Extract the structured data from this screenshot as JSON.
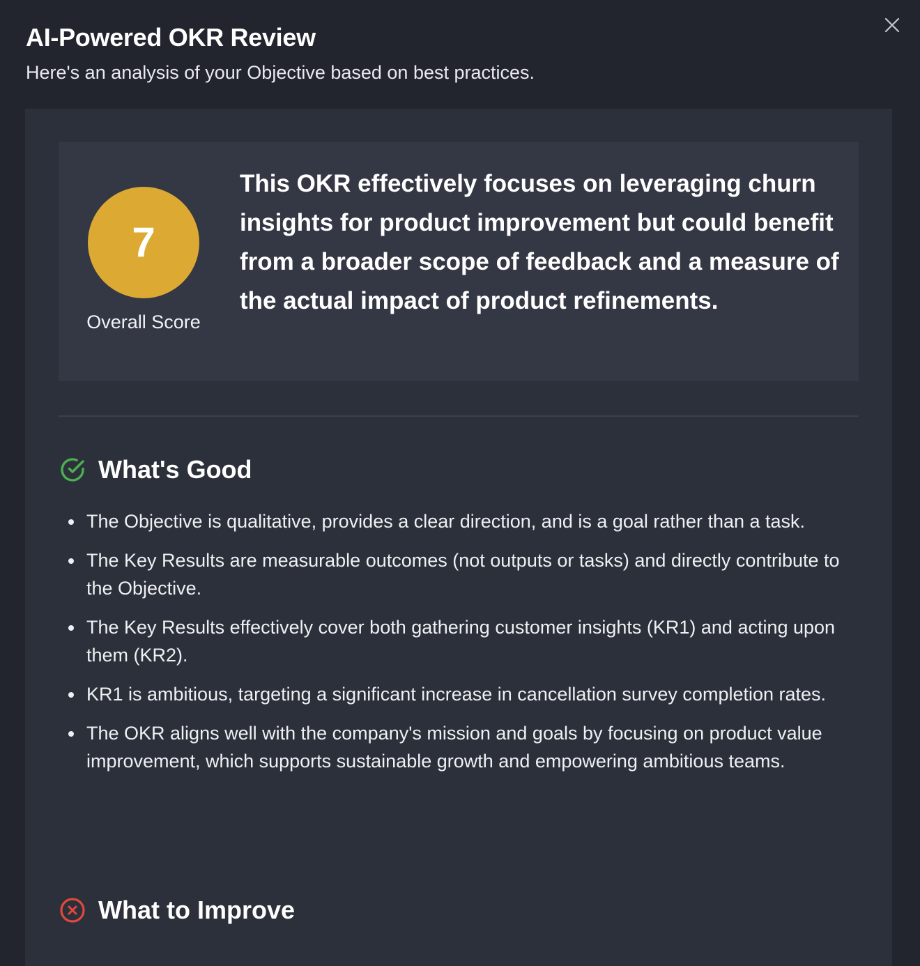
{
  "modal": {
    "title": "AI-Powered OKR Review",
    "subtitle": "Here's an analysis of your Objective based on best practices.",
    "close_icon": "close-icon"
  },
  "score": {
    "value": "7",
    "label": "Overall Score",
    "color": "#dcaa33",
    "summary": "This OKR effectively focuses on leveraging churn insights for product improvement but could benefit from a broader scope of feedback and a measure of the actual impact of product refinements."
  },
  "good": {
    "title": "What's Good",
    "icon": "check-circle-icon",
    "color": "#4caf50",
    "items": [
      "The Objective is qualitative, provides a clear direction, and is a goal rather than a task.",
      "The Key Results are measurable outcomes (not outputs or tasks) and directly contribute to the Objective.",
      "The Key Results effectively cover both gathering customer insights (KR1) and acting upon them (KR2).",
      "KR1 is ambitious, targeting a significant increase in cancellation survey completion rates.",
      "The OKR aligns well with the company's mission and goals by focusing on product value improvement, which supports sustainable growth and empowering ambitious teams."
    ]
  },
  "improve": {
    "title": "What to Improve",
    "icon": "x-circle-icon",
    "color": "#e0483e"
  }
}
